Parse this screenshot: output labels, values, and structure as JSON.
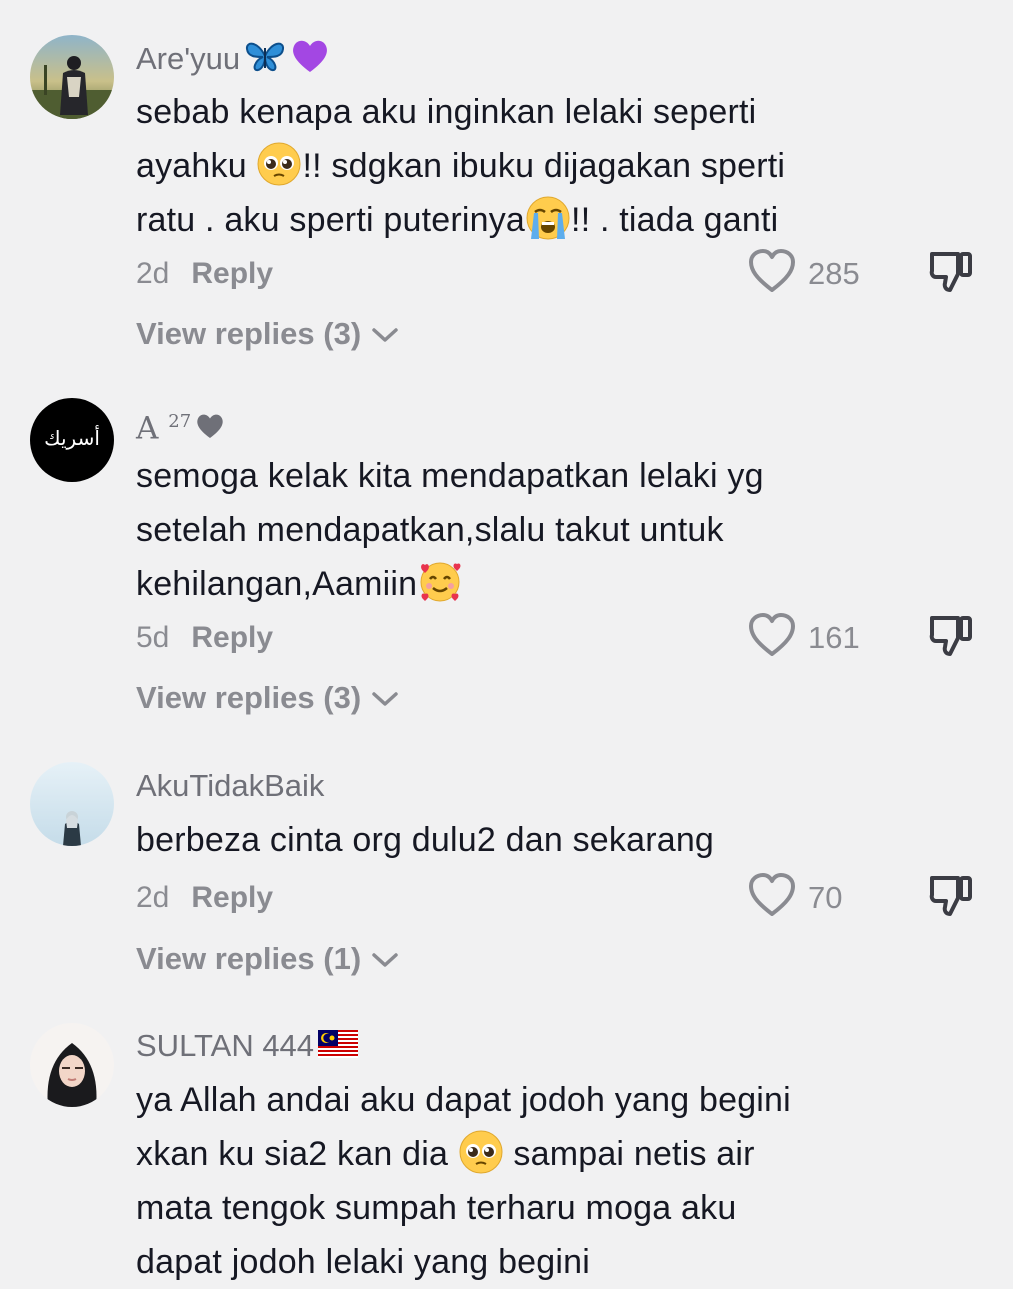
{
  "comments": [
    {
      "username": "Are'yuu",
      "text_parts": [
        "sebab kenapa aku inginkan lelaki seperti",
        "ayahku ",
        "!! sdgkan ibuku dijagakan sperti",
        "ratu . aku sperti puterinya",
        "!! . tiada ganti"
      ],
      "time": "2d",
      "reply_label": "Reply",
      "likes": "285",
      "view_replies": "View replies (3)"
    },
    {
      "username": "A",
      "username_sup": "27",
      "text_parts": [
        "semoga kelak kita mendapatkan lelaki yg",
        "setelah mendapatkan,slalu takut untuk",
        "kehilangan,Aamiin"
      ],
      "avatar_text": "أسريك",
      "time": "5d",
      "reply_label": "Reply",
      "likes": "161",
      "view_replies": "View replies (3)"
    },
    {
      "username": "AkuTidakBaik",
      "text_parts": [
        "berbeza cinta org dulu2 dan sekarang"
      ],
      "time": "2d",
      "reply_label": "Reply",
      "likes": "70",
      "view_replies": "View replies (1)"
    },
    {
      "username": "SULTAN 444",
      "text_parts": [
        "ya Allah andai aku dapat jodoh yang begini",
        "xkan ku sia2 kan dia ",
        " sampai netis air",
        "mata tengok sumpah terharu moga aku",
        "dapat jodoh lelaki yang begini"
      ]
    }
  ],
  "icons": {
    "like": "heart-outline-icon",
    "dislike": "thumbs-down-icon",
    "expand": "chevron-down-icon"
  },
  "colors": {
    "background": "#f1f1f2",
    "text": "#161823",
    "muted": "#8a8b91"
  }
}
